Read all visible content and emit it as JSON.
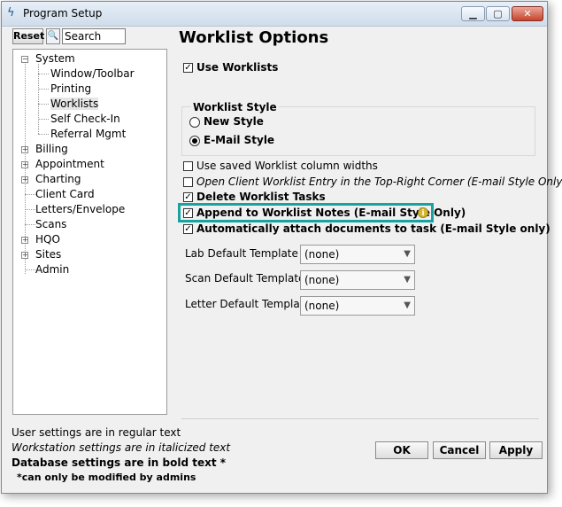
{
  "window": {
    "title": "Program Setup"
  },
  "toolbar": {
    "reset_label": "Reset",
    "search_value": "Search"
  },
  "tree": {
    "items": [
      {
        "label": "System"
      },
      {
        "label": "Window/Toolbar"
      },
      {
        "label": "Printing"
      },
      {
        "label": "Worklists",
        "selected": true
      },
      {
        "label": "Self Check-In"
      },
      {
        "label": "Referral Mgmt"
      },
      {
        "label": "Billing"
      },
      {
        "label": "Appointment"
      },
      {
        "label": "Charting"
      },
      {
        "label": "Client Card"
      },
      {
        "label": "Letters/Envelope"
      },
      {
        "label": "Scans"
      },
      {
        "label": "HQO"
      },
      {
        "label": "Sites"
      },
      {
        "label": "Admin"
      }
    ]
  },
  "main": {
    "heading": "Worklist Options",
    "use_worklists": {
      "label": "Use Worklists",
      "checked": true
    },
    "style_group": {
      "title": "Worklist Style",
      "new_style": {
        "label": "New Style",
        "selected": false
      },
      "email_style": {
        "label": "E-Mail Style",
        "selected": true
      }
    },
    "options": [
      {
        "label": "Use saved Worklist column widths",
        "checked": false
      },
      {
        "label": "Open Client Worklist Entry in the Top-Right Corner (E-mail Style Only)",
        "checked": false
      },
      {
        "label": "Delete Worklist Tasks",
        "checked": true
      },
      {
        "label": "Append to Worklist Notes (E-mail Style Only)",
        "checked": true
      },
      {
        "label": "Automatically attach documents to task (E-mail Style only)",
        "checked": true
      }
    ],
    "templates": [
      {
        "label": "Lab Default Template",
        "value": "(none)"
      },
      {
        "label": "Scan Default Template",
        "value": "(none)"
      },
      {
        "label": "Letter Default Template",
        "value": "(none)"
      }
    ]
  },
  "legend": {
    "user": "User settings are in regular text",
    "workstation": "Workstation settings are in italicized text",
    "database": "Database settings are in bold text *",
    "note": "*can only be modified by admins"
  },
  "buttons": {
    "ok": "OK",
    "cancel": "Cancel",
    "apply": "Apply"
  },
  "colors": {
    "highlight": "#17a3a0",
    "info": "#d6b830"
  }
}
